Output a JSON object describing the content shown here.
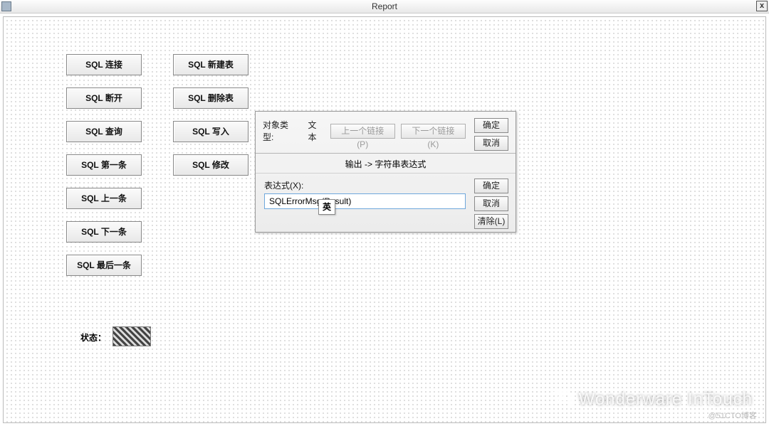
{
  "window": {
    "title": "Report",
    "close": "x"
  },
  "buttons": {
    "col1": [
      "SQL 连接",
      "SQL 断开",
      "SQL 查询",
      "SQL 第一条",
      "SQL 上一条",
      "SQL 下一条",
      "SQL 最后一条"
    ],
    "col2": [
      "SQL 新建表",
      "SQL 删除表",
      "SQL 写入",
      "SQL 修改"
    ]
  },
  "status": {
    "label": "状态："
  },
  "dialog": {
    "obj_type_label": "对象类型:",
    "obj_type_value": "文本",
    "prev_link": "上一个链接(P)",
    "next_link": "下一个链接(K)",
    "ok": "确定",
    "cancel": "取消",
    "clear": "清除(L)",
    "heading": "输出 -> 字符串表达式",
    "expr_label": "表达式(X):",
    "expr_value": "SQLErrorMsg(Result)",
    "ime": "英"
  },
  "watermark": {
    "text": "Wonderware InTouch",
    "sub": "@51CTO博客"
  }
}
